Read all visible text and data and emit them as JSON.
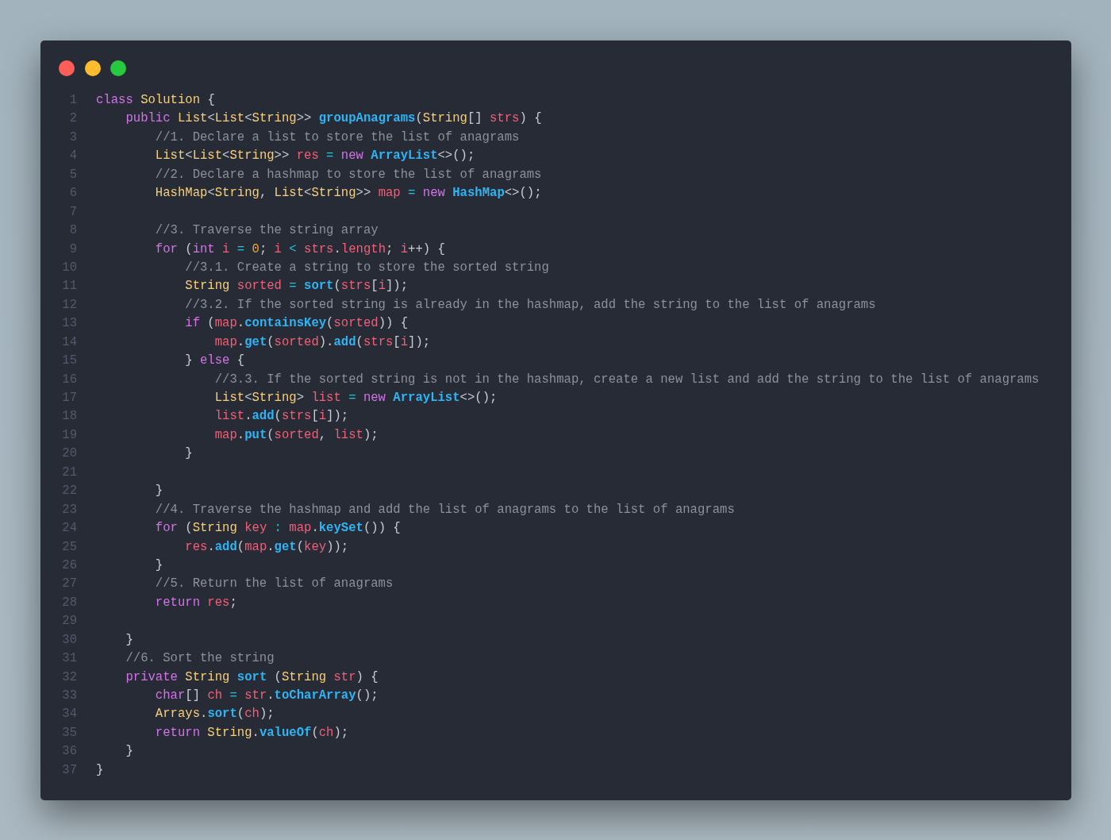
{
  "window_controls": [
    {
      "color": "#ff5f56"
    },
    {
      "color": "#ffbd2e"
    },
    {
      "color": "#27c93f"
    }
  ],
  "lines": [
    {
      "number": "1",
      "tokens": [
        {
          "text": "class",
          "kind": "keyword"
        },
        {
          "text": " Solution",
          "kind": "type"
        },
        {
          "text": " {",
          "kind": "plain"
        }
      ]
    },
    {
      "number": "2",
      "tokens": [
        {
          "text": "    public",
          "kind": "keyword"
        },
        {
          "text": " List",
          "kind": "type"
        },
        {
          "text": "<",
          "kind": "plain"
        },
        {
          "text": "List",
          "kind": "type"
        },
        {
          "text": "<",
          "kind": "plain"
        },
        {
          "text": "String",
          "kind": "type"
        },
        {
          "text": ">> ",
          "kind": "plain"
        },
        {
          "text": "groupAnagrams",
          "kind": "function"
        },
        {
          "text": "(",
          "kind": "plain"
        },
        {
          "text": "String",
          "kind": "type"
        },
        {
          "text": "[] ",
          "kind": "plain"
        },
        {
          "text": "strs",
          "kind": "variable"
        },
        {
          "text": ") {",
          "kind": "plain"
        }
      ]
    },
    {
      "number": "3",
      "tokens": [
        {
          "text": "        //1. Declare a list to store the list of anagrams",
          "kind": "comment"
        }
      ]
    },
    {
      "number": "4",
      "tokens": [
        {
          "text": "        List",
          "kind": "type"
        },
        {
          "text": "<",
          "kind": "plain"
        },
        {
          "text": "List",
          "kind": "type"
        },
        {
          "text": "<",
          "kind": "plain"
        },
        {
          "text": "String",
          "kind": "type"
        },
        {
          "text": ">> ",
          "kind": "plain"
        },
        {
          "text": "res",
          "kind": "variable"
        },
        {
          "text": " =",
          "kind": "operator"
        },
        {
          "text": " new",
          "kind": "keyword"
        },
        {
          "text": " ArrayList",
          "kind": "function"
        },
        {
          "text": "<>();",
          "kind": "plain"
        }
      ]
    },
    {
      "number": "5",
      "tokens": [
        {
          "text": "        //2. Declare a hashmap to store the list of anagrams",
          "kind": "comment"
        }
      ]
    },
    {
      "number": "6",
      "tokens": [
        {
          "text": "        HashMap",
          "kind": "type"
        },
        {
          "text": "<",
          "kind": "plain"
        },
        {
          "text": "String",
          "kind": "type"
        },
        {
          "text": ", ",
          "kind": "plain"
        },
        {
          "text": "List",
          "kind": "type"
        },
        {
          "text": "<",
          "kind": "plain"
        },
        {
          "text": "String",
          "kind": "type"
        },
        {
          "text": ">> ",
          "kind": "plain"
        },
        {
          "text": "map",
          "kind": "variable"
        },
        {
          "text": " =",
          "kind": "operator"
        },
        {
          "text": " new",
          "kind": "keyword"
        },
        {
          "text": " HashMap",
          "kind": "function"
        },
        {
          "text": "<>();",
          "kind": "plain"
        }
      ]
    },
    {
      "number": "7"
    },
    {
      "number": "8",
      "tokens": [
        {
          "text": "        //3. Traverse the string array",
          "kind": "comment"
        }
      ]
    },
    {
      "number": "9",
      "tokens": [
        {
          "text": "        for",
          "kind": "keyword"
        },
        {
          "text": " (",
          "kind": "plain"
        },
        {
          "text": "int",
          "kind": "keyword"
        },
        {
          "text": " i",
          "kind": "variable"
        },
        {
          "text": " =",
          "kind": "operator"
        },
        {
          "text": " 0",
          "kind": "number"
        },
        {
          "text": "; ",
          "kind": "plain"
        },
        {
          "text": "i",
          "kind": "variable"
        },
        {
          "text": " <",
          "kind": "operator"
        },
        {
          "text": " strs",
          "kind": "variable"
        },
        {
          "text": ".",
          "kind": "plain"
        },
        {
          "text": "length",
          "kind": "variable"
        },
        {
          "text": "; ",
          "kind": "plain"
        },
        {
          "text": "i",
          "kind": "variable"
        },
        {
          "text": "++) {",
          "kind": "plain"
        }
      ]
    },
    {
      "number": "10",
      "tokens": [
        {
          "text": "            //3.1. Create a string to store the sorted string",
          "kind": "comment"
        }
      ]
    },
    {
      "number": "11",
      "tokens": [
        {
          "text": "            String",
          "kind": "type"
        },
        {
          "text": " sorted",
          "kind": "variable"
        },
        {
          "text": " =",
          "kind": "operator"
        },
        {
          "text": " sort",
          "kind": "function"
        },
        {
          "text": "(",
          "kind": "plain"
        },
        {
          "text": "strs",
          "kind": "variable"
        },
        {
          "text": "[",
          "kind": "plain"
        },
        {
          "text": "i",
          "kind": "variable"
        },
        {
          "text": "]);",
          "kind": "plain"
        }
      ]
    },
    {
      "number": "12",
      "tokens": [
        {
          "text": "            //3.2. If the sorted string is already in the hashmap, add the string to the list of anagrams",
          "kind": "comment"
        }
      ]
    },
    {
      "number": "13",
      "tokens": [
        {
          "text": "            if",
          "kind": "keyword"
        },
        {
          "text": " (",
          "kind": "plain"
        },
        {
          "text": "map",
          "kind": "variable"
        },
        {
          "text": ".",
          "kind": "plain"
        },
        {
          "text": "containsKey",
          "kind": "function"
        },
        {
          "text": "(",
          "kind": "plain"
        },
        {
          "text": "sorted",
          "kind": "variable"
        },
        {
          "text": ")) {",
          "kind": "plain"
        }
      ]
    },
    {
      "number": "14",
      "tokens": [
        {
          "text": "                map",
          "kind": "variable"
        },
        {
          "text": ".",
          "kind": "plain"
        },
        {
          "text": "get",
          "kind": "function"
        },
        {
          "text": "(",
          "kind": "plain"
        },
        {
          "text": "sorted",
          "kind": "variable"
        },
        {
          "text": ").",
          "kind": "plain"
        },
        {
          "text": "add",
          "kind": "function"
        },
        {
          "text": "(",
          "kind": "plain"
        },
        {
          "text": "strs",
          "kind": "variable"
        },
        {
          "text": "[",
          "kind": "plain"
        },
        {
          "text": "i",
          "kind": "variable"
        },
        {
          "text": "]);",
          "kind": "plain"
        }
      ]
    },
    {
      "number": "15",
      "tokens": [
        {
          "text": "            } ",
          "kind": "plain"
        },
        {
          "text": "else",
          "kind": "keyword"
        },
        {
          "text": " {",
          "kind": "plain"
        }
      ]
    },
    {
      "number": "16",
      "tokens": [
        {
          "text": "                //3.3. If the sorted string is not in the hashmap, create a new list and add the string to the list of anagrams",
          "kind": "comment"
        }
      ]
    },
    {
      "number": "17",
      "tokens": [
        {
          "text": "                List",
          "kind": "type"
        },
        {
          "text": "<",
          "kind": "plain"
        },
        {
          "text": "String",
          "kind": "type"
        },
        {
          "text": "> ",
          "kind": "plain"
        },
        {
          "text": "list",
          "kind": "variable"
        },
        {
          "text": " =",
          "kind": "operator"
        },
        {
          "text": " new",
          "kind": "keyword"
        },
        {
          "text": " ArrayList",
          "kind": "function"
        },
        {
          "text": "<>();",
          "kind": "plain"
        }
      ]
    },
    {
      "number": "18",
      "tokens": [
        {
          "text": "                list",
          "kind": "variable"
        },
        {
          "text": ".",
          "kind": "plain"
        },
        {
          "text": "add",
          "kind": "function"
        },
        {
          "text": "(",
          "kind": "plain"
        },
        {
          "text": "strs",
          "kind": "variable"
        },
        {
          "text": "[",
          "kind": "plain"
        },
        {
          "text": "i",
          "kind": "variable"
        },
        {
          "text": "]);",
          "kind": "plain"
        }
      ]
    },
    {
      "number": "19",
      "tokens": [
        {
          "text": "                map",
          "kind": "variable"
        },
        {
          "text": ".",
          "kind": "plain"
        },
        {
          "text": "put",
          "kind": "function"
        },
        {
          "text": "(",
          "kind": "plain"
        },
        {
          "text": "sorted",
          "kind": "variable"
        },
        {
          "text": ", ",
          "kind": "plain"
        },
        {
          "text": "list",
          "kind": "variable"
        },
        {
          "text": ");",
          "kind": "plain"
        }
      ]
    },
    {
      "number": "20",
      "tokens": [
        {
          "text": "            }",
          "kind": "plain"
        }
      ]
    },
    {
      "number": "21"
    },
    {
      "number": "22",
      "tokens": [
        {
          "text": "        }",
          "kind": "plain"
        }
      ]
    },
    {
      "number": "23",
      "tokens": [
        {
          "text": "        //4. Traverse the hashmap and add the list of anagrams to the list of anagrams",
          "kind": "comment"
        }
      ]
    },
    {
      "number": "24",
      "tokens": [
        {
          "text": "        for",
          "kind": "keyword"
        },
        {
          "text": " (",
          "kind": "plain"
        },
        {
          "text": "String",
          "kind": "type"
        },
        {
          "text": " key",
          "kind": "variable"
        },
        {
          "text": " :",
          "kind": "operator"
        },
        {
          "text": " map",
          "kind": "variable"
        },
        {
          "text": ".",
          "kind": "plain"
        },
        {
          "text": "keySet",
          "kind": "function"
        },
        {
          "text": "()) {",
          "kind": "plain"
        }
      ]
    },
    {
      "number": "25",
      "tokens": [
        {
          "text": "            res",
          "kind": "variable"
        },
        {
          "text": ".",
          "kind": "plain"
        },
        {
          "text": "add",
          "kind": "function"
        },
        {
          "text": "(",
          "kind": "plain"
        },
        {
          "text": "map",
          "kind": "variable"
        },
        {
          "text": ".",
          "kind": "plain"
        },
        {
          "text": "get",
          "kind": "function"
        },
        {
          "text": "(",
          "kind": "plain"
        },
        {
          "text": "key",
          "kind": "variable"
        },
        {
          "text": "));",
          "kind": "plain"
        }
      ]
    },
    {
      "number": "26",
      "tokens": [
        {
          "text": "        }",
          "kind": "plain"
        }
      ]
    },
    {
      "number": "27",
      "tokens": [
        {
          "text": "        //5. Return the list of anagrams",
          "kind": "comment"
        }
      ]
    },
    {
      "number": "28",
      "tokens": [
        {
          "text": "        return",
          "kind": "keyword"
        },
        {
          "text": " res",
          "kind": "variable"
        },
        {
          "text": ";",
          "kind": "plain"
        }
      ]
    },
    {
      "number": "29"
    },
    {
      "number": "30",
      "tokens": [
        {
          "text": "    }",
          "kind": "plain"
        }
      ]
    },
    {
      "number": "31",
      "tokens": [
        {
          "text": "    //6. Sort the string",
          "kind": "comment"
        }
      ]
    },
    {
      "number": "32",
      "tokens": [
        {
          "text": "    private",
          "kind": "keyword"
        },
        {
          "text": " String",
          "kind": "type"
        },
        {
          "text": " sort",
          "kind": "function"
        },
        {
          "text": " (",
          "kind": "plain"
        },
        {
          "text": "String",
          "kind": "type"
        },
        {
          "text": " str",
          "kind": "variable"
        },
        {
          "text": ") {",
          "kind": "plain"
        }
      ]
    },
    {
      "number": "33",
      "tokens": [
        {
          "text": "        char",
          "kind": "keyword"
        },
        {
          "text": "[] ",
          "kind": "plain"
        },
        {
          "text": "ch",
          "kind": "variable"
        },
        {
          "text": " =",
          "kind": "operator"
        },
        {
          "text": " str",
          "kind": "variable"
        },
        {
          "text": ".",
          "kind": "plain"
        },
        {
          "text": "toCharArray",
          "kind": "function"
        },
        {
          "text": "();",
          "kind": "plain"
        }
      ]
    },
    {
      "number": "34",
      "tokens": [
        {
          "text": "        Arrays",
          "kind": "type"
        },
        {
          "text": ".",
          "kind": "plain"
        },
        {
          "text": "sort",
          "kind": "function"
        },
        {
          "text": "(",
          "kind": "plain"
        },
        {
          "text": "ch",
          "kind": "variable"
        },
        {
          "text": ");",
          "kind": "plain"
        }
      ]
    },
    {
      "number": "35",
      "tokens": [
        {
          "text": "        return",
          "kind": "keyword"
        },
        {
          "text": " String",
          "kind": "type"
        },
        {
          "text": ".",
          "kind": "plain"
        },
        {
          "text": "valueOf",
          "kind": "function"
        },
        {
          "text": "(",
          "kind": "plain"
        },
        {
          "text": "ch",
          "kind": "variable"
        },
        {
          "text": ");",
          "kind": "plain"
        }
      ]
    },
    {
      "number": "36",
      "tokens": [
        {
          "text": "    }",
          "kind": "plain"
        }
      ]
    },
    {
      "number": "37",
      "tokens": [
        {
          "text": "}",
          "kind": "plain"
        }
      ]
    }
  ]
}
